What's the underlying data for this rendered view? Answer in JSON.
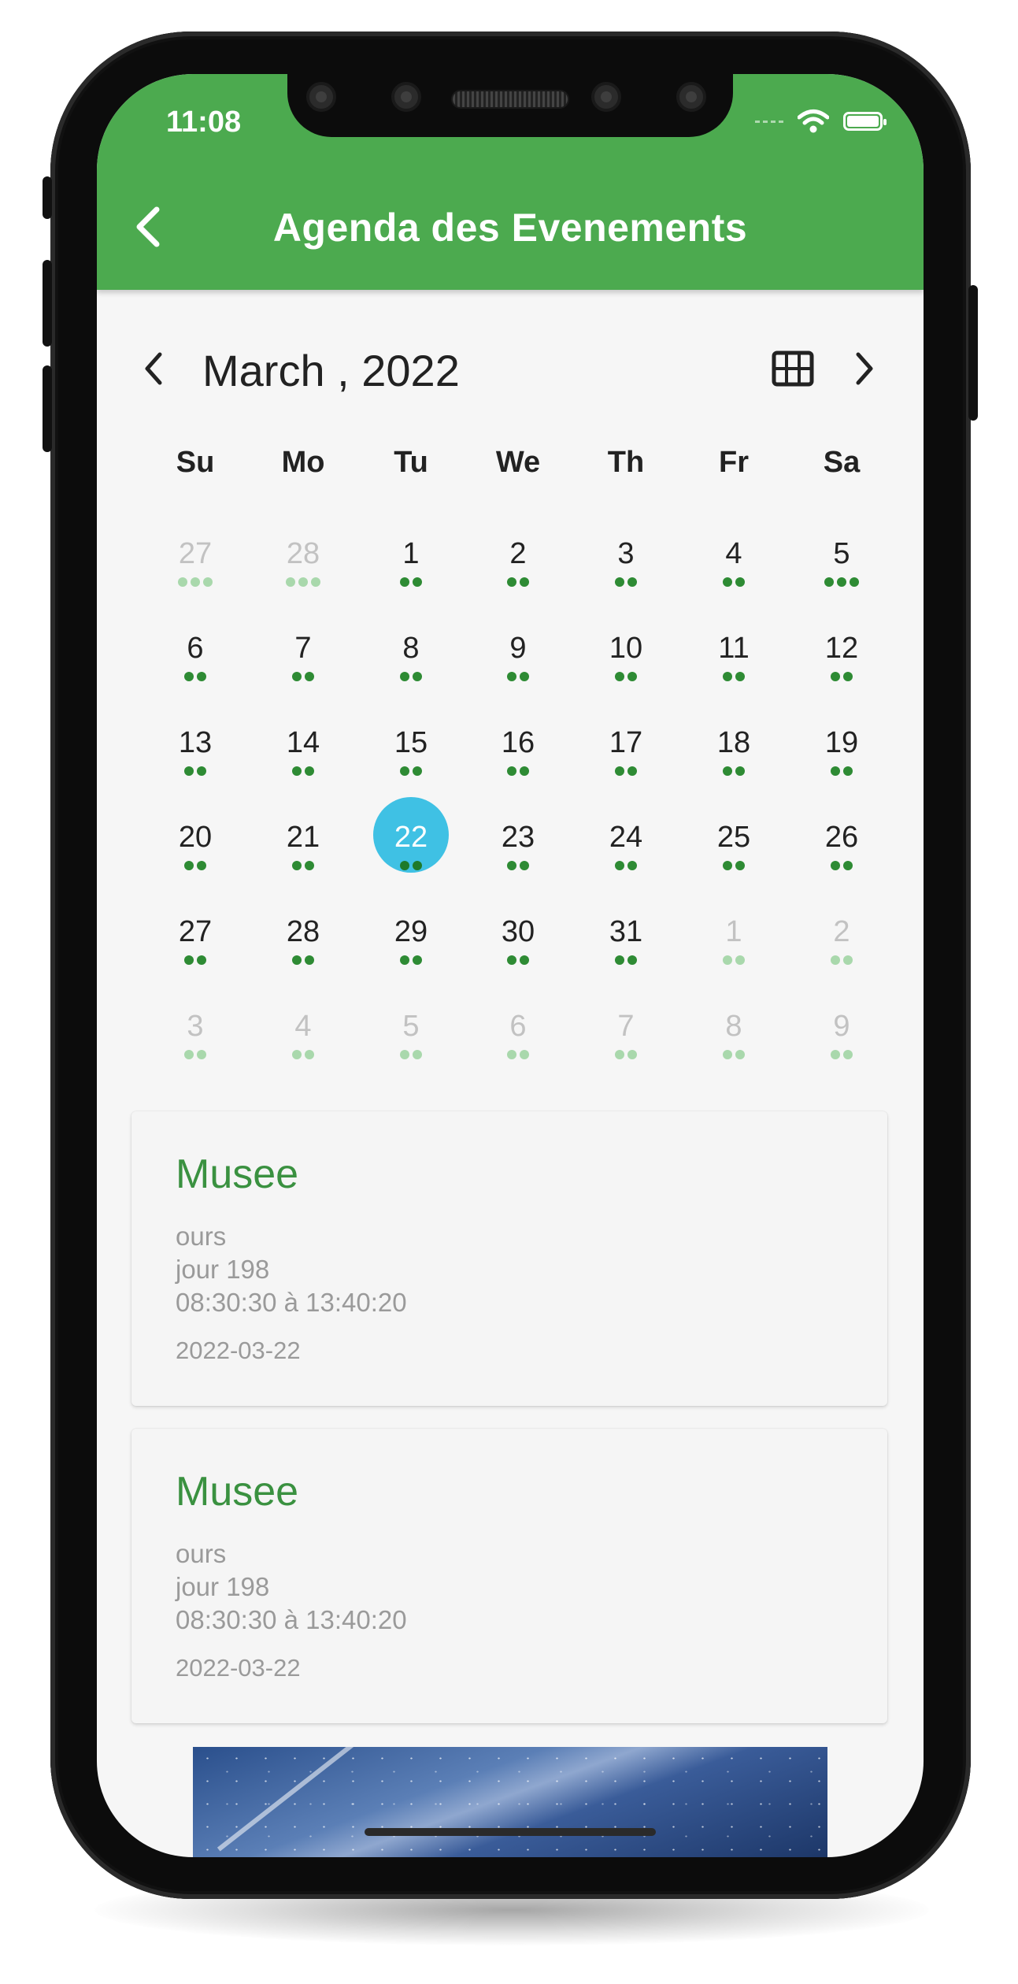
{
  "status_bar": {
    "time": "11:08"
  },
  "app_bar": {
    "title": "Agenda des Evenements"
  },
  "calendar": {
    "month": "March",
    "year": "2022",
    "month_year": "March , 2022",
    "weekdays": [
      "Su",
      "Mo",
      "Tu",
      "We",
      "Th",
      "Fr",
      "Sa"
    ],
    "days": [
      {
        "n": "27",
        "outside": true,
        "dots": 3
      },
      {
        "n": "28",
        "outside": true,
        "dots": 3
      },
      {
        "n": "1",
        "dots": 2
      },
      {
        "n": "2",
        "dots": 2
      },
      {
        "n": "3",
        "dots": 2
      },
      {
        "n": "4",
        "dots": 2
      },
      {
        "n": "5",
        "dots": 3
      },
      {
        "n": "6",
        "dots": 2
      },
      {
        "n": "7",
        "dots": 2
      },
      {
        "n": "8",
        "dots": 2
      },
      {
        "n": "9",
        "dots": 2
      },
      {
        "n": "10",
        "dots": 2
      },
      {
        "n": "11",
        "dots": 2
      },
      {
        "n": "12",
        "dots": 2
      },
      {
        "n": "13",
        "dots": 2
      },
      {
        "n": "14",
        "dots": 2
      },
      {
        "n": "15",
        "dots": 2
      },
      {
        "n": "16",
        "dots": 2
      },
      {
        "n": "17",
        "dots": 2
      },
      {
        "n": "18",
        "dots": 2
      },
      {
        "n": "19",
        "dots": 2
      },
      {
        "n": "20",
        "dots": 2
      },
      {
        "n": "21",
        "dots": 2
      },
      {
        "n": "22",
        "dots": 2,
        "selected": true
      },
      {
        "n": "23",
        "dots": 2
      },
      {
        "n": "24",
        "dots": 2
      },
      {
        "n": "25",
        "dots": 2
      },
      {
        "n": "26",
        "dots": 2
      },
      {
        "n": "27",
        "dots": 2
      },
      {
        "n": "28",
        "dots": 2
      },
      {
        "n": "29",
        "dots": 2
      },
      {
        "n": "30",
        "dots": 2
      },
      {
        "n": "31",
        "dots": 2
      },
      {
        "n": "1",
        "outside": true,
        "dots": 2
      },
      {
        "n": "2",
        "outside": true,
        "dots": 2
      },
      {
        "n": "3",
        "outside": true,
        "dots": 2
      },
      {
        "n": "4",
        "outside": true,
        "dots": 2
      },
      {
        "n": "5",
        "outside": true,
        "dots": 2
      },
      {
        "n": "6",
        "outside": true,
        "dots": 2
      },
      {
        "n": "7",
        "outside": true,
        "dots": 2
      },
      {
        "n": "8",
        "outside": true,
        "dots": 2
      },
      {
        "n": "9",
        "outside": true,
        "dots": 2
      }
    ]
  },
  "events": [
    {
      "title": "Musee",
      "subtitle": "ours",
      "day": "jour 198",
      "time_range": "08:30:30 à 13:40:20",
      "date": "2022-03-22"
    },
    {
      "title": "Musee",
      "subtitle": "ours",
      "day": "jour 198",
      "time_range": "08:30:30 à 13:40:20",
      "date": "2022-03-22"
    }
  ],
  "colors": {
    "app_bar": "#4caa4f",
    "selected_day": "#3fc1e4",
    "event_dot": "#2e8b34",
    "event_title": "#3a9140"
  },
  "icons": {
    "back": "chevron-left-icon",
    "prev_month": "chevron-left-icon",
    "next_month": "chevron-right-icon",
    "view_toggle": "grid-icon",
    "wifi": "wifi-icon",
    "battery": "battery-icon"
  }
}
